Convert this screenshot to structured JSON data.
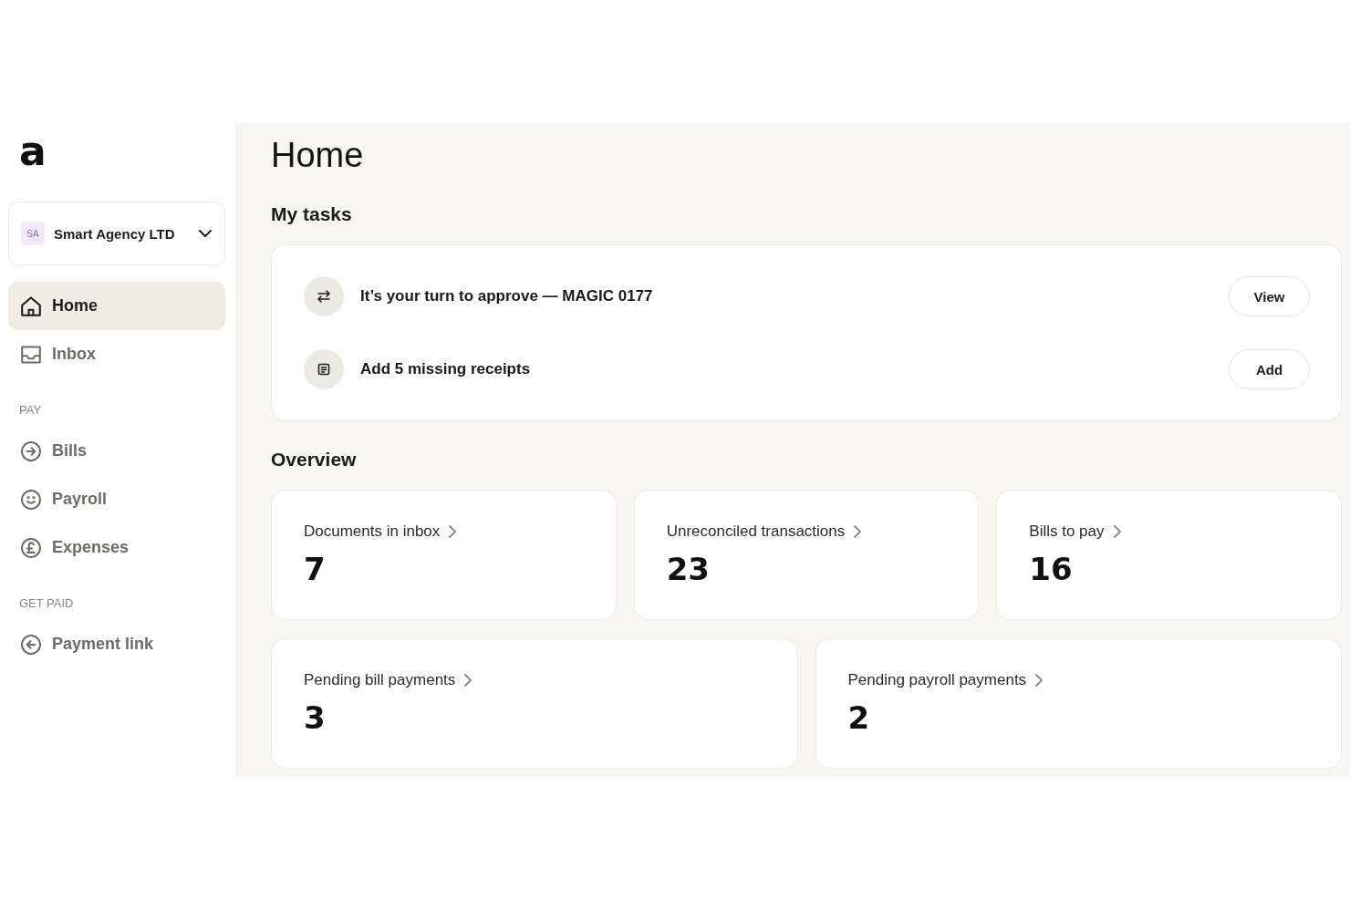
{
  "logo": {
    "text": "a"
  },
  "org_switcher": {
    "initials": "SA",
    "name": "Smart Agency LTD"
  },
  "nav": [
    {
      "items": [
        {
          "label": "Home",
          "selected": true
        },
        {
          "label": "Inbox",
          "selected": false
        }
      ]
    },
    {
      "heading": "PAY",
      "items": [
        {
          "label": "Bills",
          "selected": false
        },
        {
          "label": "Payroll",
          "selected": false
        },
        {
          "label": "Expenses",
          "selected": false
        }
      ]
    },
    {
      "heading": "GET PAID",
      "items": [
        {
          "label": "Payment link",
          "selected": false
        }
      ]
    }
  ],
  "page_title": "Home",
  "tasks": {
    "heading": "My tasks",
    "items": [
      {
        "text": "It’s your turn to approve — MAGIC 0177",
        "action": "View"
      },
      {
        "text": "Add 5 missing receipts",
        "action": "Add"
      }
    ]
  },
  "overview": {
    "heading": "Overview",
    "rows": [
      [
        {
          "label": "Documents in inbox",
          "value": "7"
        },
        {
          "label": "Unreconciled transactions",
          "value": "23"
        },
        {
          "label": "Bills to pay",
          "value": "16"
        }
      ],
      [
        {
          "label": "Pending bill payments",
          "value": "3"
        },
        {
          "label": "Pending payroll payments",
          "value": "2"
        }
      ]
    ]
  }
}
